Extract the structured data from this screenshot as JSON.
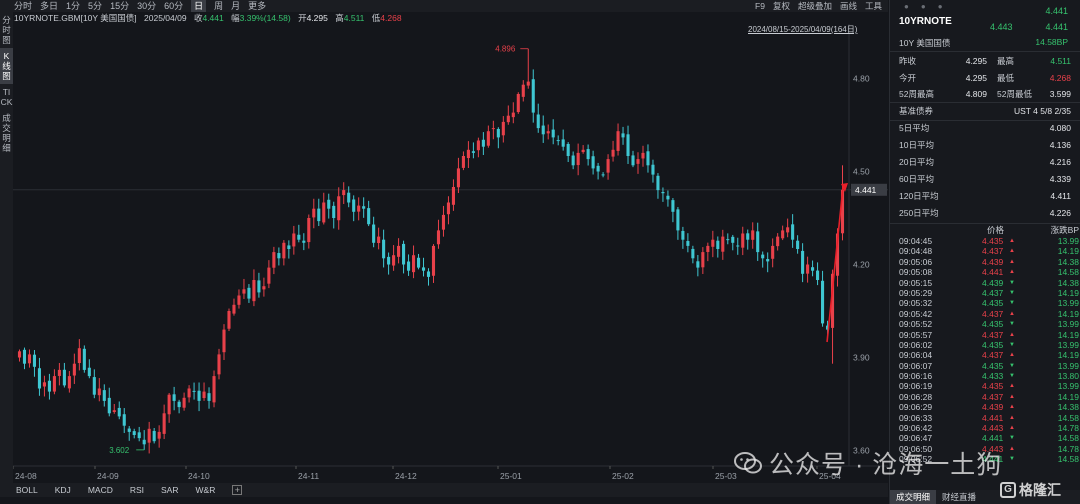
{
  "toolbar": {
    "periods": [
      "分时",
      "多日",
      "1分",
      "5分",
      "15分",
      "30分",
      "60分",
      "日",
      "周",
      "月",
      "更多"
    ],
    "active_period": "日",
    "tools": [
      "F9",
      "复权",
      "超级叠加",
      "画线",
      "工具"
    ]
  },
  "left_tabs": [
    "分时图",
    "K线图",
    "TICK",
    "成交明细"
  ],
  "active_left_tab": "K线图",
  "info": {
    "symbol": "10YRNOTE.GBM[10Y 美国国债]",
    "date": "2025/04/09",
    "close_label": "收",
    "close": "4.441",
    "change_label": "幅",
    "change": "3.39%(14.58)",
    "open_label": "开",
    "open": "4.295",
    "high_label": "高",
    "high": "4.511",
    "low_label": "低",
    "low": "4.268"
  },
  "date_range": "2024/08/15-2025/04/09(164日)",
  "bottom_tabs": [
    "BOLL",
    "KDJ",
    "MACD",
    "RSI",
    "SAR",
    "W&R"
  ],
  "chart_data": {
    "type": "candlestick",
    "x_tick_labels": [
      "24-08",
      "24-09",
      "24-10",
      "24-11",
      "24-12",
      "25-01",
      "25-02",
      "25-03",
      "25-04"
    ],
    "y_tick_labels": [
      "4.80",
      "4.50",
      "4.20",
      "3.90",
      "3.60"
    ],
    "y_ticks": [
      4.8,
      4.5,
      4.2,
      3.9,
      3.6
    ],
    "ylim": [
      3.55,
      4.95
    ],
    "max_annotation": "4.896",
    "max_value": 4.896,
    "min_annotation": "3.602",
    "min_value": 3.602,
    "last_price_label": "4.441",
    "last_price": 4.441,
    "up_color": "#e8414a",
    "down_color": "#3fc7d2",
    "closes": [
      3.92,
      3.88,
      3.91,
      3.87,
      3.8,
      3.82,
      3.79,
      3.84,
      3.86,
      3.81,
      3.84,
      3.88,
      3.93,
      3.86,
      3.84,
      3.78,
      3.8,
      3.76,
      3.72,
      3.73,
      3.71,
      3.68,
      3.66,
      3.65,
      3.64,
      3.62,
      3.67,
      3.63,
      3.66,
      3.72,
      3.78,
      3.76,
      3.74,
      3.77,
      3.8,
      3.79,
      3.76,
      3.79,
      3.76,
      3.84,
      3.91,
      3.99,
      4.05,
      4.07,
      4.1,
      4.12,
      4.09,
      4.15,
      4.11,
      4.13,
      4.19,
      4.24,
      4.22,
      4.27,
      4.25,
      4.3,
      4.28,
      4.27,
      4.35,
      4.38,
      4.34,
      4.4,
      4.38,
      4.35,
      4.42,
      4.44,
      4.4,
      4.37,
      4.39,
      4.38,
      4.33,
      4.27,
      4.29,
      4.22,
      4.2,
      4.23,
      4.26,
      4.2,
      4.18,
      4.23,
      4.19,
      4.18,
      4.16,
      4.26,
      4.31,
      4.36,
      4.4,
      4.45,
      4.51,
      4.55,
      4.57,
      4.56,
      4.6,
      4.58,
      4.63,
      4.64,
      4.61,
      4.66,
      4.68,
      4.69,
      4.75,
      4.78,
      4.79,
      4.69,
      4.64,
      4.62,
      4.63,
      4.61,
      4.6,
      4.58,
      4.55,
      4.52,
      4.56,
      4.57,
      4.54,
      4.51,
      4.5,
      4.49,
      4.54,
      4.57,
      4.63,
      4.61,
      4.55,
      4.52,
      4.54,
      4.56,
      4.52,
      4.49,
      4.44,
      4.43,
      4.41,
      4.37,
      4.31,
      4.28,
      4.26,
      4.22,
      4.19,
      4.24,
      4.26,
      4.28,
      4.25,
      4.29,
      4.28,
      4.27,
      4.26,
      4.3,
      4.28,
      4.31,
      4.24,
      4.22,
      4.21,
      4.26,
      4.29,
      4.31,
      4.32,
      4.28,
      4.25,
      4.17,
      4.2,
      4.18,
      4.15,
      4.01,
      3.99,
      4.17,
      4.3,
      4.441
    ]
  },
  "right_panel": {
    "symbol": "10YRNOTE",
    "last": "4.441",
    "bid": "4.443",
    "ask": "4.441",
    "name": "10Y 美国国债",
    "change": "14.58BP",
    "quotes": [
      {
        "l1": "昨收",
        "v1": "4.295",
        "l2": "最高",
        "v2": "4.511",
        "v2c": "#36c26e"
      },
      {
        "l1": "今开",
        "v1": "4.295",
        "l2": "最低",
        "v2": "4.268",
        "v2c": "#e8414a"
      },
      {
        "l1": "52周最高",
        "v1": "4.809",
        "l2": "52周最低",
        "v2": "3.599",
        "v2c": "#e4e6ea"
      }
    ],
    "benchmark_label": "基准债券",
    "benchmark_value": "UST 4 5/8 2/35",
    "averages": [
      {
        "label": "5日平均",
        "value": "4.080"
      },
      {
        "label": "10日平均",
        "value": "4.136"
      },
      {
        "label": "20日平均",
        "value": "4.216"
      },
      {
        "label": "60日平均",
        "value": "4.339"
      },
      {
        "label": "120日平均",
        "value": "4.411"
      },
      {
        "label": "250日平均",
        "value": "4.226"
      }
    ],
    "tick_header_price": "价格",
    "tick_header_bp": "涨跌BP",
    "ticks": [
      {
        "time": "09:04:45",
        "price": "4.435",
        "bp": "13.99"
      },
      {
        "time": "09:04:48",
        "price": "4.437",
        "bp": "14.19"
      },
      {
        "time": "09:05:06",
        "price": "4.439",
        "bp": "14.38"
      },
      {
        "time": "09:05:08",
        "price": "4.441",
        "bp": "14.58"
      },
      {
        "time": "09:05:15",
        "price": "4.439",
        "bp": "14.38"
      },
      {
        "time": "09:05:29",
        "price": "4.437",
        "bp": "14.19"
      },
      {
        "time": "09:05:32",
        "price": "4.435",
        "bp": "13.99"
      },
      {
        "time": "09:05:42",
        "price": "4.437",
        "bp": "14.19"
      },
      {
        "time": "09:05:52",
        "price": "4.435",
        "bp": "13.99"
      },
      {
        "time": "09:05:57",
        "price": "4.437",
        "bp": "14.19"
      },
      {
        "time": "09:06:02",
        "price": "4.435",
        "bp": "13.99"
      },
      {
        "time": "09:06:04",
        "price": "4.437",
        "bp": "14.19"
      },
      {
        "time": "09:06:07",
        "price": "4.435",
        "bp": "13.99"
      },
      {
        "time": "09:06:16",
        "price": "4.433",
        "bp": "13.80"
      },
      {
        "time": "09:06:19",
        "price": "4.435",
        "bp": "13.99"
      },
      {
        "time": "09:06:28",
        "price": "4.437",
        "bp": "14.19"
      },
      {
        "time": "09:06:29",
        "price": "4.439",
        "bp": "14.38"
      },
      {
        "time": "09:06:33",
        "price": "4.441",
        "bp": "14.58"
      },
      {
        "time": "09:06:42",
        "price": "4.443",
        "bp": "14.78"
      },
      {
        "time": "09:06:47",
        "price": "4.441",
        "bp": "14.58"
      },
      {
        "time": "09:06:50",
        "price": "4.443",
        "bp": "14.78"
      },
      {
        "time": "09:06:52",
        "price": "4.441",
        "bp": "14.58"
      }
    ],
    "bottom_tabs": [
      "成交明细",
      "财经直播"
    ],
    "active_bottom_tab": "成交明细"
  },
  "watermark": {
    "text": "公众号 · 沧海一土狗",
    "brand": "格隆汇",
    "brand_mark": "G"
  }
}
